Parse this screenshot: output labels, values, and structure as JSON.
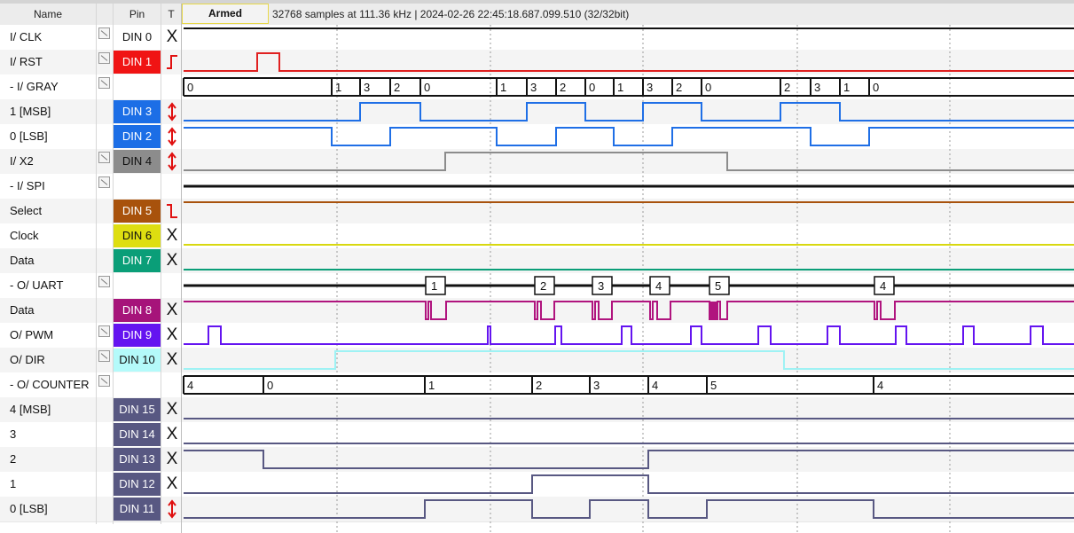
{
  "header": {
    "name_col": "Name",
    "pin_col": "Pin",
    "trigger_col": "T",
    "status_button": "Armed",
    "info": "32768 samples at 111.36 kHz | 2024-02-26 22:45:18.687.099.510 (32/32bit)"
  },
  "rows": [
    {
      "name": "I/ CLK",
      "pin": "DIN  0",
      "pin_bg": "#ffffff",
      "pin_fg": "#111111",
      "trig": "X",
      "note": true
    },
    {
      "name": "I/ RST",
      "pin": "DIN  1",
      "pin_bg": "#f01414",
      "pin_fg": "#ffffff",
      "trig": "rise",
      "note": true
    },
    {
      "name": "- I/ GRAY",
      "pin": "",
      "trig": "",
      "note": true
    },
    {
      "name": "1 [MSB]",
      "pin": "DIN  3",
      "pin_bg": "#1c6ee6",
      "pin_fg": "#ffffff",
      "trig": "both",
      "note": false
    },
    {
      "name": "0 [LSB]",
      "pin": "DIN  2",
      "pin_bg": "#1c6ee6",
      "pin_fg": "#ffffff",
      "trig": "both",
      "note": false
    },
    {
      "name": "I/ X2",
      "pin": "DIN  4",
      "pin_bg": "#8c8c8c",
      "pin_fg": "#111111",
      "trig": "both",
      "note": true
    },
    {
      "name": "- I/ SPI",
      "pin": "",
      "trig": "",
      "note": true
    },
    {
      "name": "Select",
      "pin": "DIN  5",
      "pin_bg": "#a8520c",
      "pin_fg": "#ffffff",
      "trig": "fall",
      "note": false
    },
    {
      "name": "Clock",
      "pin": "DIN  6",
      "pin_bg": "#dede10",
      "pin_fg": "#111111",
      "trig": "X",
      "note": false
    },
    {
      "name": "Data",
      "pin": "DIN  7",
      "pin_bg": "#0a9e78",
      "pin_fg": "#ffffff",
      "trig": "X",
      "note": false
    },
    {
      "name": "- O/ UART",
      "pin": "",
      "trig": "",
      "note": true
    },
    {
      "name": "Data",
      "pin": "DIN  8",
      "pin_bg": "#a6147a",
      "pin_fg": "#ffffff",
      "trig": "X",
      "note": false
    },
    {
      "name": "O/ PWM",
      "pin": "DIN  9",
      "pin_bg": "#6414f0",
      "pin_fg": "#ffffff",
      "trig": "X",
      "note": true
    },
    {
      "name": "O/ DIR",
      "pin": "DIN 10",
      "pin_bg": "#b4fafa",
      "pin_fg": "#111111",
      "trig": "X",
      "note": true
    },
    {
      "name": "- O/ COUNTER",
      "pin": "",
      "trig": "",
      "note": true
    },
    {
      "name": "4 [MSB]",
      "pin": "DIN 15",
      "pin_bg": "#585882",
      "pin_fg": "#ffffff",
      "trig": "X",
      "note": false
    },
    {
      "name": "3",
      "pin": "DIN 14",
      "pin_bg": "#585882",
      "pin_fg": "#ffffff",
      "trig": "X",
      "note": false
    },
    {
      "name": "2",
      "pin": "DIN 13",
      "pin_bg": "#585882",
      "pin_fg": "#ffffff",
      "trig": "X",
      "note": false
    },
    {
      "name": "1",
      "pin": "DIN 12",
      "pin_bg": "#585882",
      "pin_fg": "#ffffff",
      "trig": "X",
      "note": false
    },
    {
      "name": "0 [LSB]",
      "pin": "DIN 11",
      "pin_bg": "#585882",
      "pin_fg": "#ffffff",
      "trig": "both",
      "note": false
    }
  ],
  "traces": [
    {
      "type": "line",
      "color": "#111111",
      "level": 1
    },
    {
      "type": "digital",
      "color": "#e02020",
      "init": 0,
      "edges": [
        290,
        315
      ]
    },
    {
      "type": "bus",
      "color": "#111111",
      "edges": [
        207,
        374,
        406,
        440,
        474,
        560,
        594,
        627,
        660,
        692,
        725,
        758,
        791,
        880,
        914,
        947,
        980
      ],
      "labels": [
        "0",
        "1",
        "3",
        "2",
        "0",
        "1",
        "3",
        "2",
        "0",
        "1",
        "3",
        "2",
        "0",
        "2",
        "3",
        "1",
        "0"
      ]
    },
    {
      "type": "digital",
      "color": "#1f6fe6",
      "init": 0,
      "edges": [
        406,
        474,
        594,
        660,
        725,
        791,
        880,
        947
      ]
    },
    {
      "type": "digital",
      "color": "#1f6fe6",
      "init": 1,
      "edges": [
        374,
        440,
        560,
        627,
        692,
        758,
        914,
        980
      ]
    },
    {
      "type": "digital",
      "color": "#8c8c8c",
      "init": 0,
      "edges": [
        502,
        820
      ]
    },
    {
      "type": "line",
      "color": "#111111",
      "level": 0.5,
      "thick": true
    },
    {
      "type": "line",
      "color": "#a8520c",
      "level": 1
    },
    {
      "type": "line",
      "color": "#d8d810",
      "level": 0
    },
    {
      "type": "line",
      "color": "#0a9e78",
      "level": 0
    },
    {
      "type": "uart",
      "color": "#111111",
      "boxes": [
        [
          480,
          "1"
        ],
        [
          603,
          "2"
        ],
        [
          668,
          "3"
        ],
        [
          733,
          "4"
        ],
        [
          800,
          "5"
        ],
        [
          986,
          "4"
        ]
      ]
    },
    {
      "type": "digital",
      "color": "#b0147e",
      "init": 1,
      "edges": [
        480,
        483,
        486,
        503,
        603,
        606,
        610,
        625,
        668,
        671,
        675,
        690,
        733,
        736,
        741,
        756,
        800,
        809,
        812,
        820,
        986,
        989,
        993,
        1009
      ],
      "fill": [
        [
          800,
          809
        ]
      ]
    },
    {
      "type": "digital",
      "color": "#6414f0",
      "init": 0,
      "edges": [
        235,
        249,
        550,
        553,
        626,
        633,
        701,
        712,
        779,
        791,
        855,
        869,
        933,
        947,
        1010,
        1022,
        1086,
        1098,
        1162,
        1176
      ]
    },
    {
      "type": "digital",
      "color": "#9ef2f4",
      "init": 0,
      "edges": [
        378,
        884
      ]
    },
    {
      "type": "bus",
      "color": "#111111",
      "edges": [
        207,
        297,
        479,
        600,
        665,
        731,
        797,
        985
      ],
      "labels": [
        "4",
        "0",
        "1",
        "2",
        "3",
        "4",
        "5",
        "4"
      ]
    },
    {
      "type": "line",
      "color": "#585882",
      "level": 0
    },
    {
      "type": "line",
      "color": "#585882",
      "level": 0
    },
    {
      "type": "digital",
      "color": "#585882",
      "init": 1,
      "edges": [
        297,
        731
      ]
    },
    {
      "type": "digital",
      "color": "#585882",
      "init": 0,
      "edges": [
        600,
        731
      ]
    },
    {
      "type": "digital",
      "color": "#585882",
      "init": 0,
      "edges": [
        479,
        600,
        665,
        731,
        797,
        985
      ]
    }
  ],
  "grid": {
    "dotted_x": [
      380,
      553,
      725,
      899,
      1071
    ]
  }
}
